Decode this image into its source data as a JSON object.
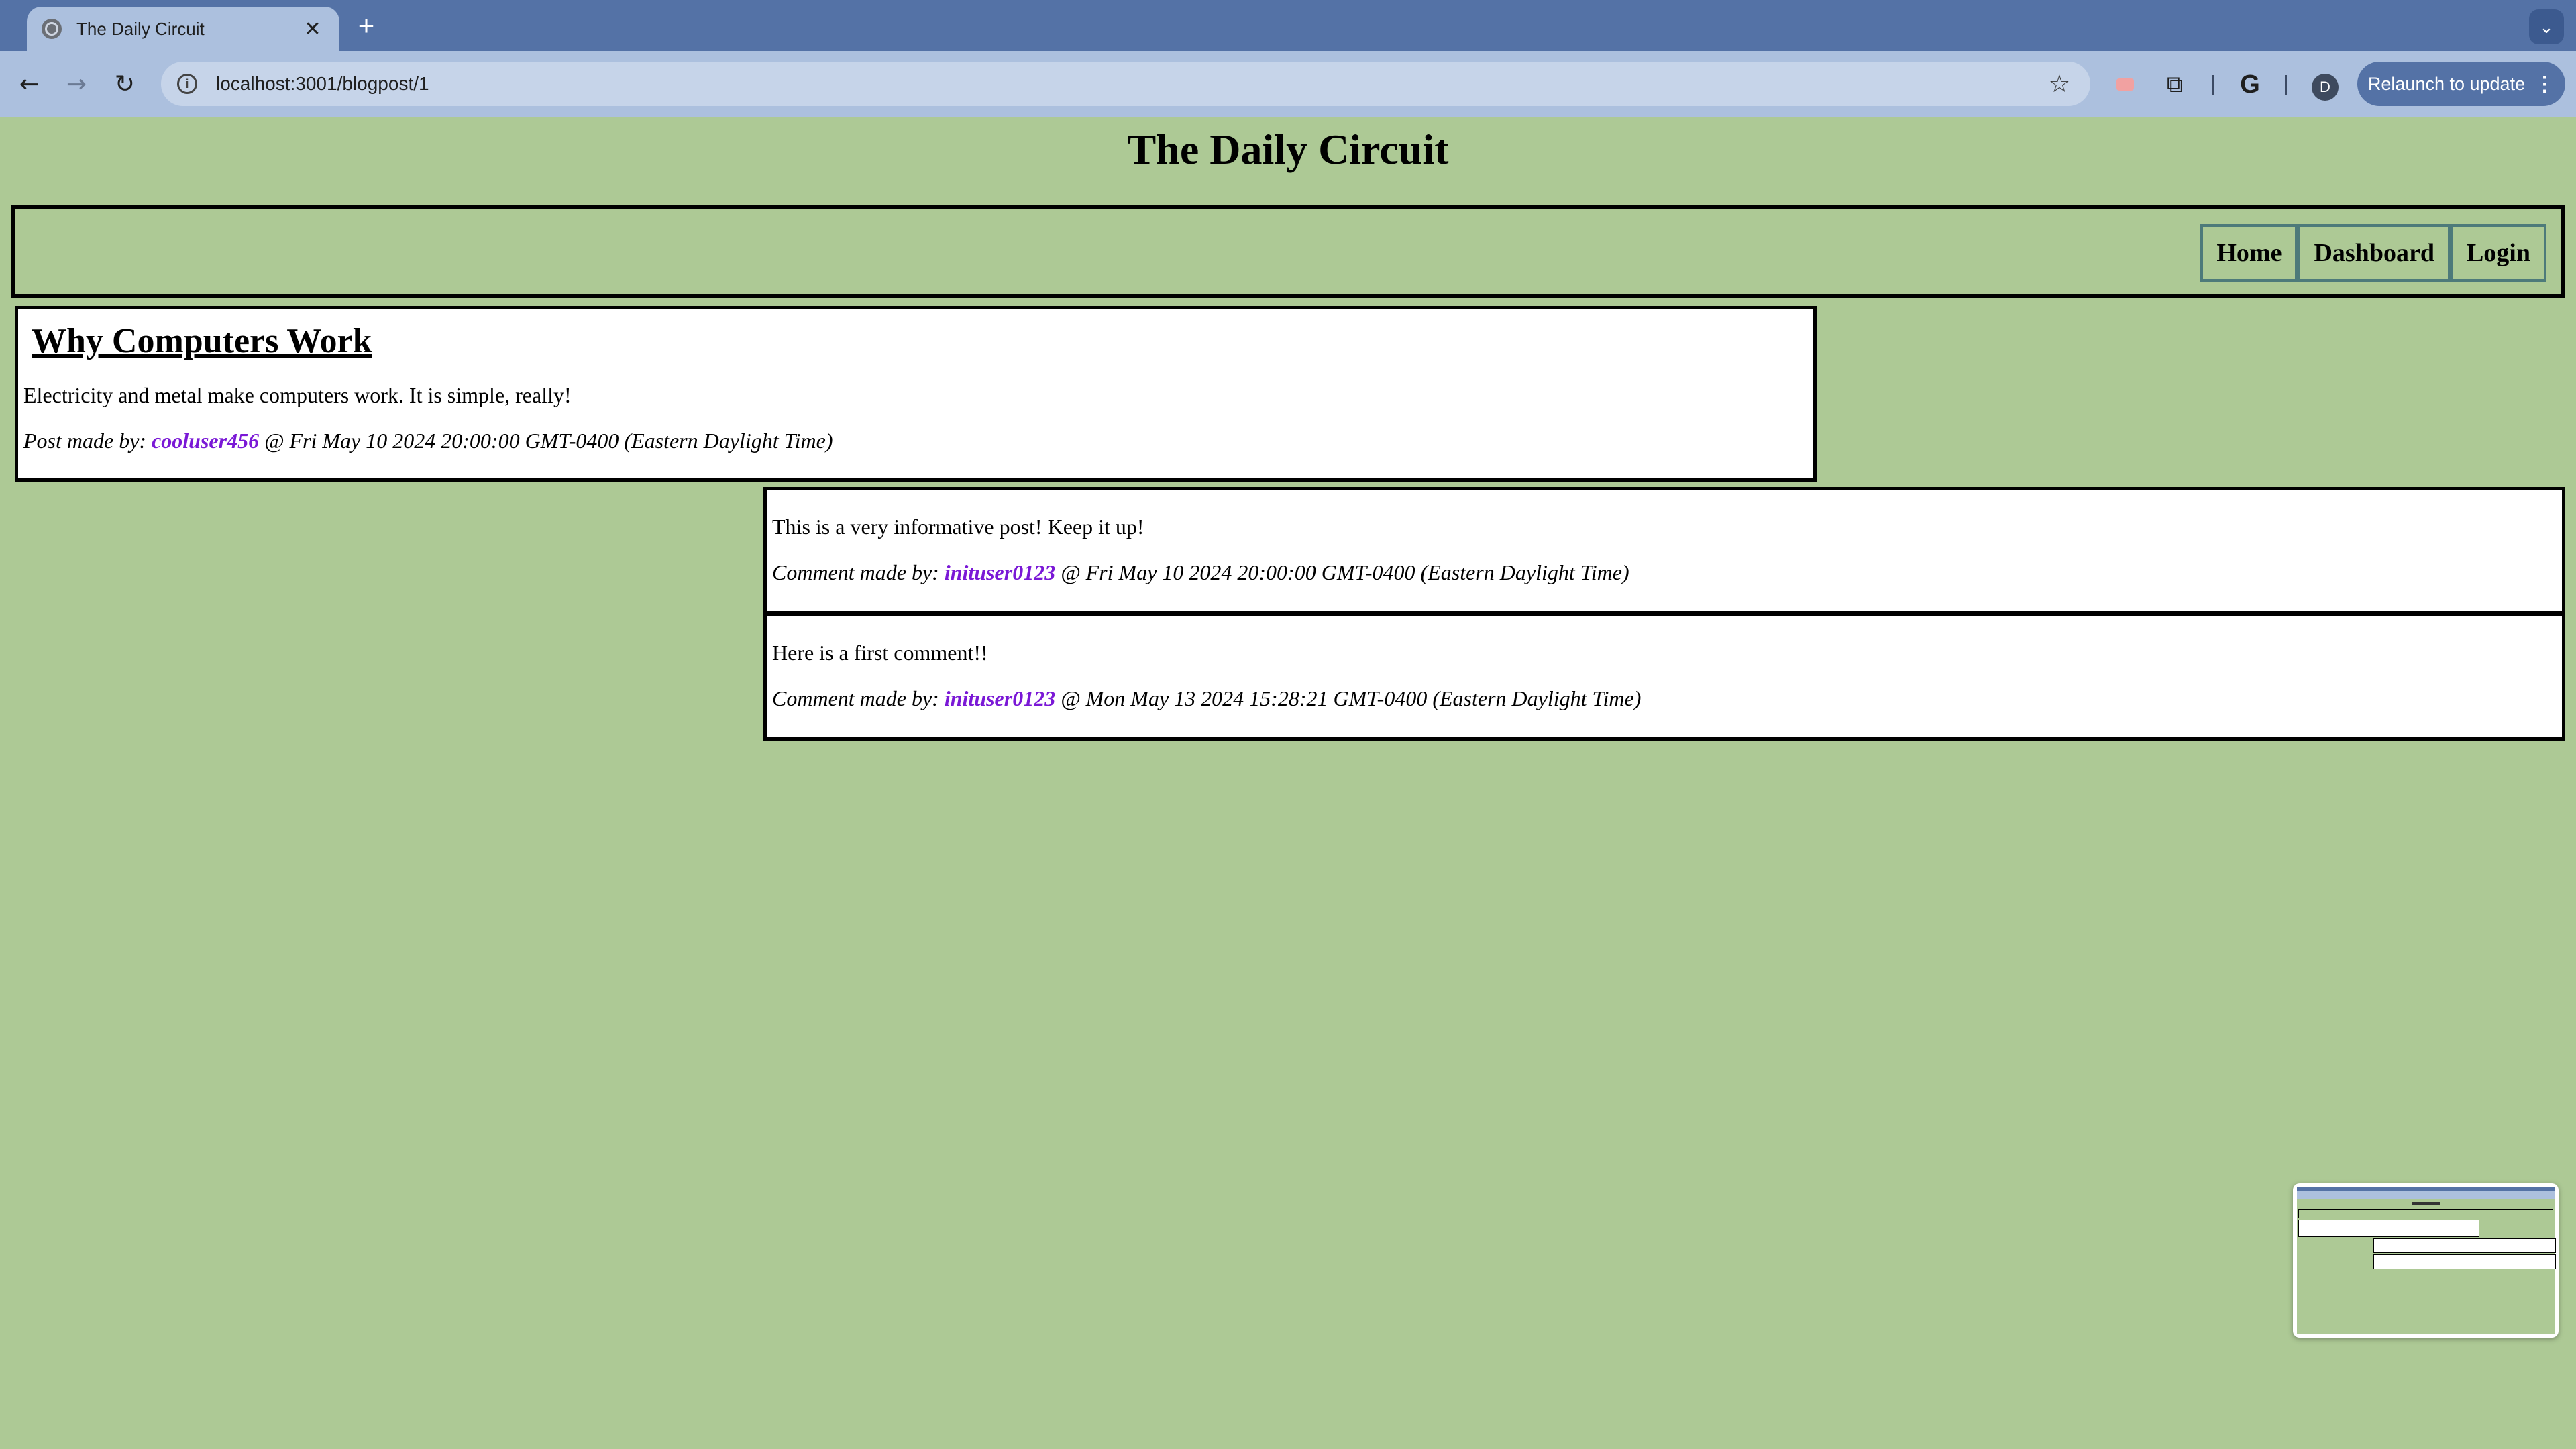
{
  "browser": {
    "tab_title": "The Daily Circuit",
    "tab_close": "✕",
    "new_tab": "+",
    "tab_search": "⌄",
    "back": "←",
    "forward": "→",
    "reload": "↻",
    "url": "localhost:3001/blogpost/1",
    "info": "i",
    "star": "☆",
    "extensions_icon": "⧉",
    "google_icon": "G",
    "profile_initial": "D",
    "relaunch_label": "Relaunch to update",
    "relaunch_menu": "⋮"
  },
  "site": {
    "title": "The Daily Circuit",
    "nav": {
      "home": "Home",
      "dashboard": "Dashboard",
      "login": "Login"
    }
  },
  "post": {
    "title": "Why Computers Work",
    "body": "Electricity and metal make computers work. It is simple, really!",
    "meta_prefix": "Post made by: ",
    "author": "cooluser456",
    "date": " @ Fri May 10 2024 20:00:00 GMT-0400 (Eastern Daylight Time)"
  },
  "comments": [
    {
      "text": "This is a very informative post! Keep it up!",
      "meta_prefix": "Comment made by: ",
      "author": "inituser0123",
      "date": " @ Fri May 10 2024 20:00:00 GMT-0400 (Eastern Daylight Time)"
    },
    {
      "text": "Here is a first comment!!",
      "meta_prefix": "Comment made by: ",
      "author": "inituser0123",
      "date": " @ Mon May 13 2024 15:28:21 GMT-0400 (Eastern Daylight Time)"
    }
  ],
  "colors": {
    "page_background": "#adc995",
    "username": "#7a18d6",
    "chrome_frame": "#5472a6",
    "toolbar": "#acc0de"
  }
}
